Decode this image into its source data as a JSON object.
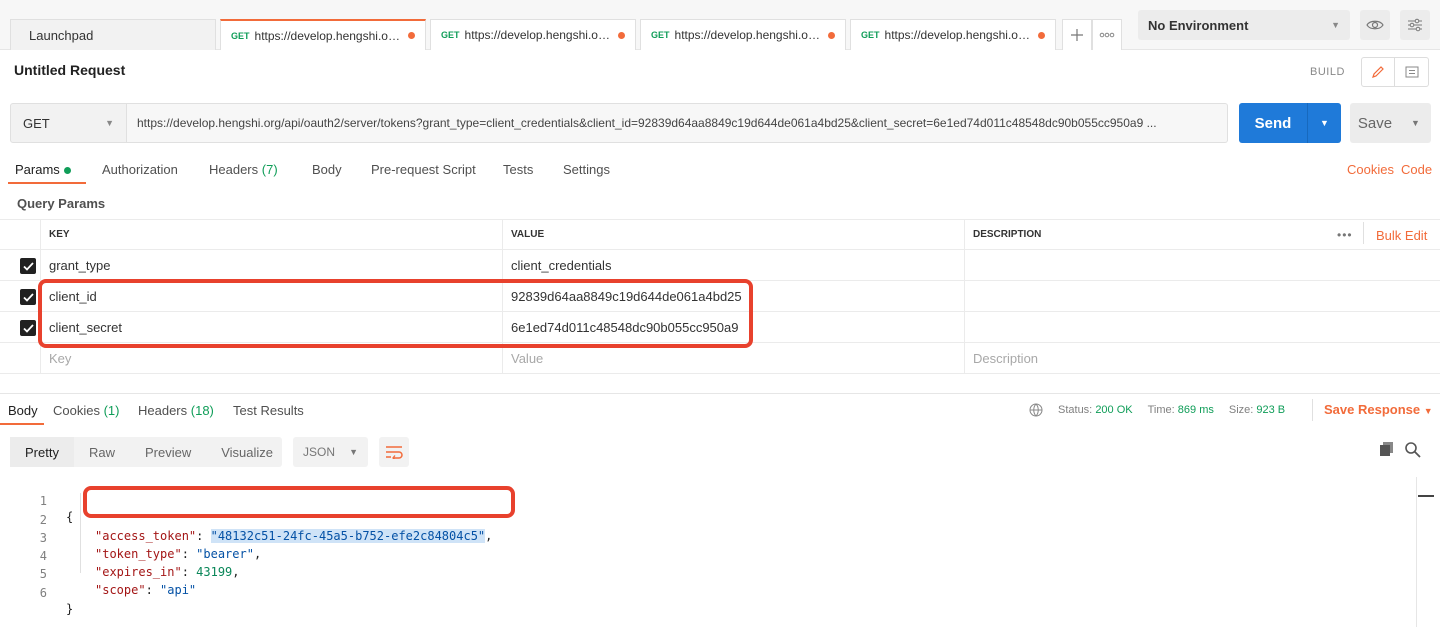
{
  "tabs": {
    "launchpad": "Launchpad",
    "items": [
      {
        "method": "GET",
        "url": "https://develop.hengshi.org..."
      },
      {
        "method": "GET",
        "url": "https://develop.hengshi.org..."
      },
      {
        "method": "GET",
        "url": "https://develop.hengshi.org..."
      },
      {
        "method": "GET",
        "url": "https://develop.hengshi.org..."
      }
    ],
    "add_icon": "plus-icon",
    "more_icon": "more-dots-icon"
  },
  "environment": {
    "selected": "No Environment",
    "eye_icon": "eye-icon",
    "settings_icon": "sliders-icon"
  },
  "request": {
    "title": "Untitled Request",
    "build_label": "BUILD",
    "method": "GET",
    "url": "https://develop.hengshi.org/api/oauth2/server/tokens?grant_type=client_credentials&client_id=92839d64aa8849c19d644de061a4bd25&client_secret=6e1ed74d011c48548dc90b055cc950a9 ...",
    "send_label": "Send",
    "save_label": "Save"
  },
  "subtabs": {
    "params": "Params",
    "authorization": "Authorization",
    "headers": "Headers",
    "headers_count": "(7)",
    "body": "Body",
    "prerequest": "Pre-request Script",
    "tests": "Tests",
    "settings": "Settings",
    "cookies": "Cookies",
    "code": "Code"
  },
  "query_params": {
    "title": "Query Params",
    "columns": {
      "key": "KEY",
      "value": "VALUE",
      "description": "DESCRIPTION"
    },
    "bulk_edit": "Bulk Edit",
    "rows": [
      {
        "key": "grant_type",
        "value": "client_credentials",
        "checked": true
      },
      {
        "key": "client_id",
        "value": "92839d64aa8849c19d644de061a4bd25",
        "checked": true
      },
      {
        "key": "client_secret",
        "value": "6e1ed74d011c48548dc90b055cc950a9",
        "checked": true
      }
    ],
    "placeholder": {
      "key": "Key",
      "value": "Value",
      "description": "Description"
    }
  },
  "response": {
    "tabs": {
      "body": "Body",
      "cookies": "Cookies",
      "cookies_count": "(1)",
      "headers": "Headers",
      "headers_count": "(18)",
      "test_results": "Test Results"
    },
    "status_label": "Status:",
    "status_value": "200 OK",
    "time_label": "Time:",
    "time_value": "869 ms",
    "size_label": "Size:",
    "size_value": "923 B",
    "save_response": "Save Response",
    "formats": [
      "Pretty",
      "Raw",
      "Preview",
      "Visualize"
    ],
    "active_format": "Pretty",
    "language": "JSON",
    "json": {
      "access_token_key": "\"access_token\"",
      "access_token_value": "\"48132c51-24fc-45a5-b752-efe2c84804c5\"",
      "token_type_key": "\"token_type\"",
      "token_type_value": "\"bearer\"",
      "expires_in_key": "\"expires_in\"",
      "expires_in_value": "43199",
      "scope_key": "\"scope\"",
      "scope_value": "\"api\""
    },
    "line_numbers": [
      "1",
      "2",
      "3",
      "4",
      "5",
      "6"
    ]
  },
  "colors": {
    "accent": "#f26b3a",
    "send_button": "#1f7ad9",
    "success": "#0f9d58",
    "highlight_box": "#e8412d"
  }
}
